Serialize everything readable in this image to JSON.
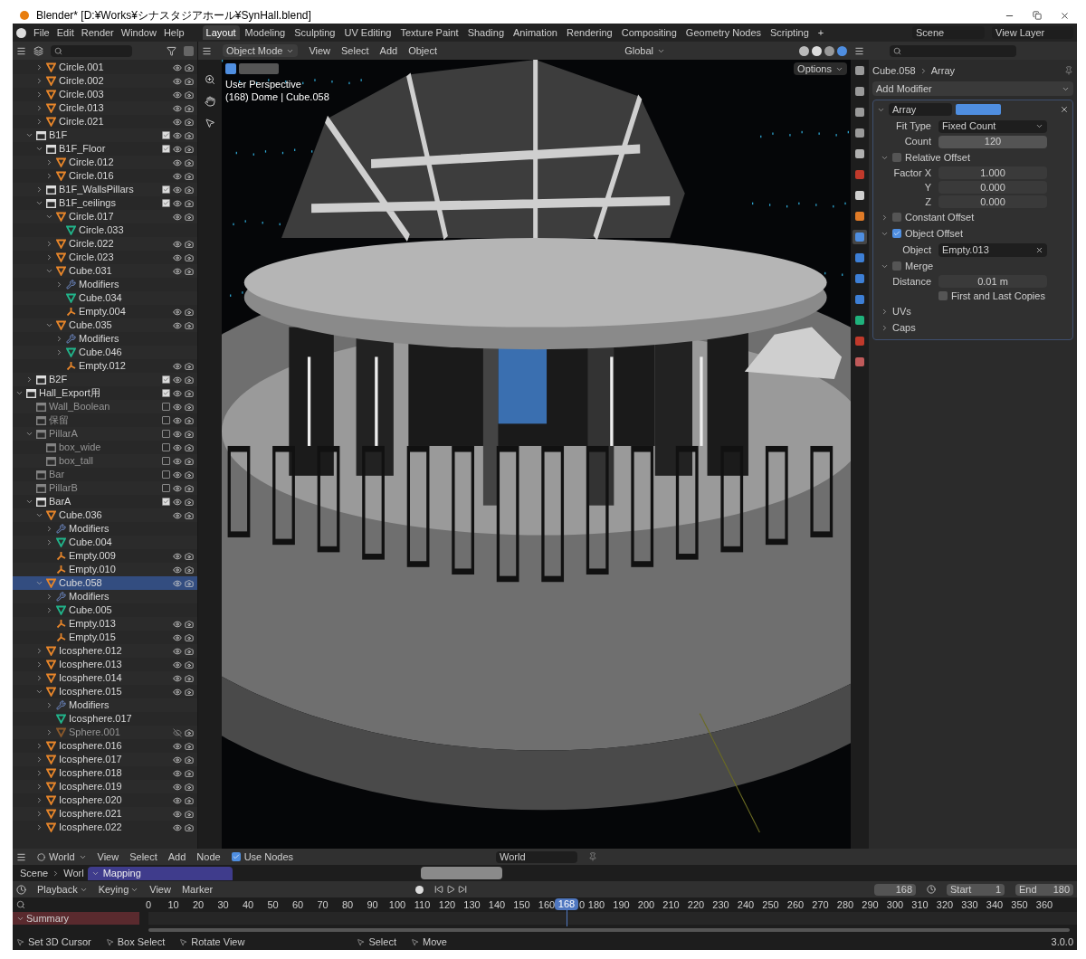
{
  "window": {
    "title": "Blender* [D:¥Works¥シナスタジアホール¥SynHall.blend]"
  },
  "menu": [
    "File",
    "Edit",
    "Render",
    "Window",
    "Help"
  ],
  "workspaces": [
    {
      "label": "Layout",
      "selected": true
    },
    {
      "label": "Modeling",
      "selected": false
    },
    {
      "label": "Sculpting",
      "selected": false
    },
    {
      "label": "UV Editing",
      "selected": false
    },
    {
      "label": "Texture Paint",
      "selected": false
    },
    {
      "label": "Shading",
      "selected": false
    },
    {
      "label": "Animation",
      "selected": false
    },
    {
      "label": "Rendering",
      "selected": false
    },
    {
      "label": "Compositing",
      "selected": false
    },
    {
      "label": "Geometry Nodes",
      "selected": false
    },
    {
      "label": "Scripting",
      "selected": false
    }
  ],
  "add_workspace": "+",
  "scene": "Scene",
  "view_layer": "View Layer",
  "outliner": {
    "cut_off_children": [
      {
        "label": "Circle.001",
        "kind": "object",
        "expanded": false,
        "selected": false,
        "visible": true
      },
      {
        "label": "Circle.002",
        "kind": "object",
        "expanded": false,
        "selected": false,
        "visible": true
      },
      {
        "label": "Circle.003",
        "kind": "object",
        "expanded": false,
        "selected": false,
        "visible": true
      },
      {
        "label": "Circle.013",
        "kind": "object",
        "expanded": false,
        "selected": false,
        "visible": true
      },
      {
        "label": "Circle.021",
        "kind": "object",
        "expanded": false,
        "selected": false,
        "visible": true
      }
    ],
    "cut_off_siblings": [
      {
        "label": "B1F",
        "kind": "collection",
        "expanded": true,
        "selected": false,
        "visible": true,
        "checked": true,
        "children": [
          {
            "label": "B1F_Floor",
            "kind": "collection",
            "expanded": true,
            "selected": false,
            "visible": true,
            "checked": true,
            "children": [
              {
                "label": "Circle.012",
                "kind": "object",
                "expanded": false,
                "selected": false,
                "visible": true
              },
              {
                "label": "Circle.016",
                "kind": "object",
                "expanded": false,
                "selected": false,
                "visible": true
              }
            ]
          },
          {
            "label": "B1F_WallsPillars",
            "kind": "collection",
            "expanded": false,
            "selected": false,
            "visible": true,
            "checked": true
          },
          {
            "label": "B1F_ceilings",
            "kind": "collection",
            "expanded": true,
            "selected": false,
            "visible": true,
            "checked": true,
            "children": [
              {
                "label": "Circle.017",
                "kind": "object",
                "expanded": true,
                "selected": false,
                "visible": true,
                "children": [
                  {
                    "label": "Circle.033",
                    "kind": "mesh",
                    "selected": false
                  }
                ]
              },
              {
                "label": "Circle.022",
                "kind": "object",
                "expanded": false,
                "selected": false,
                "visible": true
              },
              {
                "label": "Circle.023",
                "kind": "object",
                "expanded": false,
                "selected": false,
                "visible": true
              },
              {
                "label": "Cube.031",
                "kind": "object",
                "expanded": true,
                "selected": false,
                "visible": true,
                "children": [
                  {
                    "label": "Modifiers",
                    "kind": "modifiers",
                    "expanded": false,
                    "selected": false
                  },
                  {
                    "label": "Cube.034",
                    "kind": "mesh",
                    "selected": false
                  },
                  {
                    "label": "Empty.004",
                    "kind": "empty",
                    "selected": false,
                    "visible": true
                  }
                ]
              },
              {
                "label": "Cube.035",
                "kind": "object",
                "expanded": true,
                "selected": false,
                "visible": true,
                "children": [
                  {
                    "label": "Modifiers",
                    "kind": "modifiers",
                    "expanded": false,
                    "selected": false
                  },
                  {
                    "label": "Cube.046",
                    "kind": "mesh",
                    "expanded": false,
                    "selected": false
                  },
                  {
                    "label": "Empty.012",
                    "kind": "empty",
                    "selected": false,
                    "visible": true
                  }
                ]
              }
            ]
          }
        ]
      },
      {
        "label": "B2F",
        "kind": "collection",
        "expanded": false,
        "selected": false,
        "visible": true,
        "checked": true
      }
    ],
    "tree": [
      {
        "label": "Hall_Export用",
        "kind": "collection",
        "expanded": true,
        "selected": false,
        "visible": true,
        "checked": true,
        "children": [
          {
            "label": "Wall_Boolean",
            "kind": "collection",
            "selected": false,
            "visible": true,
            "checked": false
          },
          {
            "label": "保留",
            "kind": "collection",
            "selected": false,
            "visible": true,
            "checked": false
          },
          {
            "label": "PillarA",
            "kind": "collection",
            "expanded": true,
            "selected": false,
            "visible": true,
            "checked": false,
            "children": [
              {
                "label": "box_wide",
                "kind": "collection",
                "selected": false,
                "visible": true,
                "checked": false
              },
              {
                "label": "box_tall",
                "kind": "collection",
                "selected": false,
                "visible": true,
                "checked": false
              }
            ]
          },
          {
            "label": "Bar",
            "kind": "collection",
            "selected": false,
            "visible": true,
            "checked": false
          },
          {
            "label": "PillarB",
            "kind": "collection",
            "selected": false,
            "visible": true,
            "checked": false
          },
          {
            "label": "BarA",
            "kind": "collection",
            "expanded": true,
            "selected": false,
            "visible": true,
            "checked": true,
            "children": [
              {
                "label": "Cube.036",
                "kind": "object",
                "expanded": true,
                "selected": false,
                "visible": true,
                "children": [
                  {
                    "label": "Modifiers",
                    "kind": "modifiers",
                    "expanded": false,
                    "selected": false
                  },
                  {
                    "label": "Cube.004",
                    "kind": "mesh",
                    "expanded": false,
                    "selected": false
                  },
                  {
                    "label": "Empty.009",
                    "kind": "empty",
                    "selected": false,
                    "visible": true
                  },
                  {
                    "label": "Empty.010",
                    "kind": "empty",
                    "selected": false,
                    "visible": true
                  }
                ]
              },
              {
                "label": "Cube.058",
                "kind": "object",
                "expanded": true,
                "selected": true,
                "visible": true,
                "children": [
                  {
                    "label": "Modifiers",
                    "kind": "modifiers",
                    "expanded": false,
                    "selected": false
                  },
                  {
                    "label": "Cube.005",
                    "kind": "mesh",
                    "expanded": false,
                    "selected": false
                  },
                  {
                    "label": "Empty.013",
                    "kind": "empty",
                    "selected": false,
                    "visible": true
                  },
                  {
                    "label": "Empty.015",
                    "kind": "empty",
                    "selected": false,
                    "visible": true
                  }
                ]
              },
              {
                "label": "Icosphere.012",
                "kind": "object",
                "expanded": false,
                "selected": false,
                "visible": true
              },
              {
                "label": "Icosphere.013",
                "kind": "object",
                "expanded": false,
                "selected": false,
                "visible": true
              },
              {
                "label": "Icosphere.014",
                "kind": "object",
                "expanded": false,
                "selected": false,
                "visible": true
              },
              {
                "label": "Icosphere.015",
                "kind": "object",
                "expanded": true,
                "selected": false,
                "visible": true,
                "children": [
                  {
                    "label": "Modifiers",
                    "kind": "modifiers",
                    "expanded": false,
                    "selected": false
                  },
                  {
                    "label": "Icosphere.017",
                    "kind": "mesh",
                    "selected": false
                  },
                  {
                    "label": "Sphere.001",
                    "kind": "object",
                    "expanded": false,
                    "selected": false,
                    "visible": false
                  }
                ]
              },
              {
                "label": "Icosphere.016",
                "kind": "object",
                "expanded": false,
                "selected": false,
                "visible": true
              },
              {
                "label": "Icosphere.017",
                "kind": "object",
                "expanded": false,
                "selected": false,
                "visible": true
              },
              {
                "label": "Icosphere.018",
                "kind": "object",
                "expanded": false,
                "selected": false,
                "visible": true
              },
              {
                "label": "Icosphere.019",
                "kind": "object",
                "expanded": false,
                "selected": false,
                "visible": true
              },
              {
                "label": "Icosphere.020",
                "kind": "object",
                "expanded": false,
                "selected": false,
                "visible": true
              },
              {
                "label": "Icosphere.021",
                "kind": "object",
                "expanded": false,
                "selected": false,
                "visible": true
              },
              {
                "label": "Icosphere.022",
                "kind": "object",
                "expanded": false,
                "selected": false,
                "visible": true
              }
            ]
          }
        ]
      }
    ]
  },
  "viewport": {
    "mode": "Object Mode",
    "menus": [
      "View",
      "Select",
      "Add",
      "Object"
    ],
    "orientation": "Global",
    "options": "Options",
    "perspective": "User Perspective",
    "info": "(168) Dome | Cube.058"
  },
  "properties": {
    "tabs": [
      {
        "color": "#9a9a9a",
        "selected": false
      },
      {
        "color": "#9a9a9a",
        "selected": false
      },
      {
        "color": "#9a9a9a",
        "selected": false
      },
      {
        "color": "#9a9a9a",
        "selected": false
      },
      {
        "color": "#b0b0b0",
        "selected": false
      },
      {
        "color": "#c0392b",
        "selected": false
      },
      {
        "color": "#d0d0d0",
        "selected": false
      },
      {
        "color": "#e07b27",
        "selected": false
      },
      {
        "color": "#4f8ee0",
        "selected": true
      },
      {
        "color": "#3d7fd6",
        "selected": false
      },
      {
        "color": "#3d7fd6",
        "selected": false
      },
      {
        "color": "#3d7fd6",
        "selected": false
      },
      {
        "color": "#1fb27c",
        "selected": false
      },
      {
        "color": "#c0392b",
        "selected": false
      },
      {
        "color": "#c05a5a",
        "selected": false
      }
    ],
    "object": "Cube.058",
    "modifier_crumb": "Array",
    "add_modifier": "Add Modifier",
    "modifier": {
      "name": "Array",
      "fit_type_label": "Fit Type",
      "fit_type": "Fixed Count",
      "count_label": "Count",
      "count": "120",
      "relative_offset": {
        "label": "Relative Offset",
        "checked": false,
        "expanded": true,
        "fields": [
          {
            "label": "Factor X",
            "value": "1.000"
          },
          {
            "label": "Y",
            "value": "0.000"
          },
          {
            "label": "Z",
            "value": "0.000"
          }
        ]
      },
      "constant_offset": {
        "label": "Constant Offset",
        "checked": false,
        "expanded": false
      },
      "object_offset": {
        "label": "Object Offset",
        "checked": true,
        "expanded": true,
        "object_label": "Object",
        "object": "Empty.013"
      },
      "merge": {
        "label": "Merge",
        "checked": false,
        "expanded": true,
        "distance_label": "Distance",
        "distance": "0.01 m",
        "first_last": "First and Last Copies",
        "first_last_checked": false
      },
      "subpanels": [
        {
          "label": "UVs",
          "expanded": false
        },
        {
          "label": "Caps",
          "expanded": false
        }
      ]
    }
  },
  "node_editor": {
    "world": "World",
    "menus": [
      "View",
      "Select",
      "Add",
      "Node"
    ],
    "use_nodes": "Use Nodes",
    "use_nodes_checked": true,
    "world_field": "World",
    "crumbs": [
      "Scene",
      "Worl"
    ],
    "node_title": "Mapping"
  },
  "timeline": {
    "menus": [
      "Playback",
      "Keying",
      "View",
      "Marker"
    ],
    "current": "168",
    "start_label": "Start",
    "start": "1",
    "end_label": "End",
    "end": "180",
    "ticks": [
      "0",
      "10",
      "20",
      "30",
      "40",
      "50",
      "60",
      "70",
      "80",
      "90",
      "100",
      "110",
      "120",
      "130",
      "140",
      "150",
      "160",
      "0",
      "180",
      "190",
      "200",
      "210",
      "220",
      "230",
      "240",
      "250",
      "260",
      "270",
      "280",
      "290",
      "300",
      "310",
      "320",
      "330",
      "340",
      "350",
      "360"
    ],
    "playhead": {
      "label": "168",
      "level": 0.4667
    },
    "summary": "Summary"
  },
  "status_bar": {
    "hints": [
      "Set 3D Cursor",
      "Box Select",
      "Rotate View",
      "Select",
      "Move"
    ],
    "version": "3.0.0"
  }
}
